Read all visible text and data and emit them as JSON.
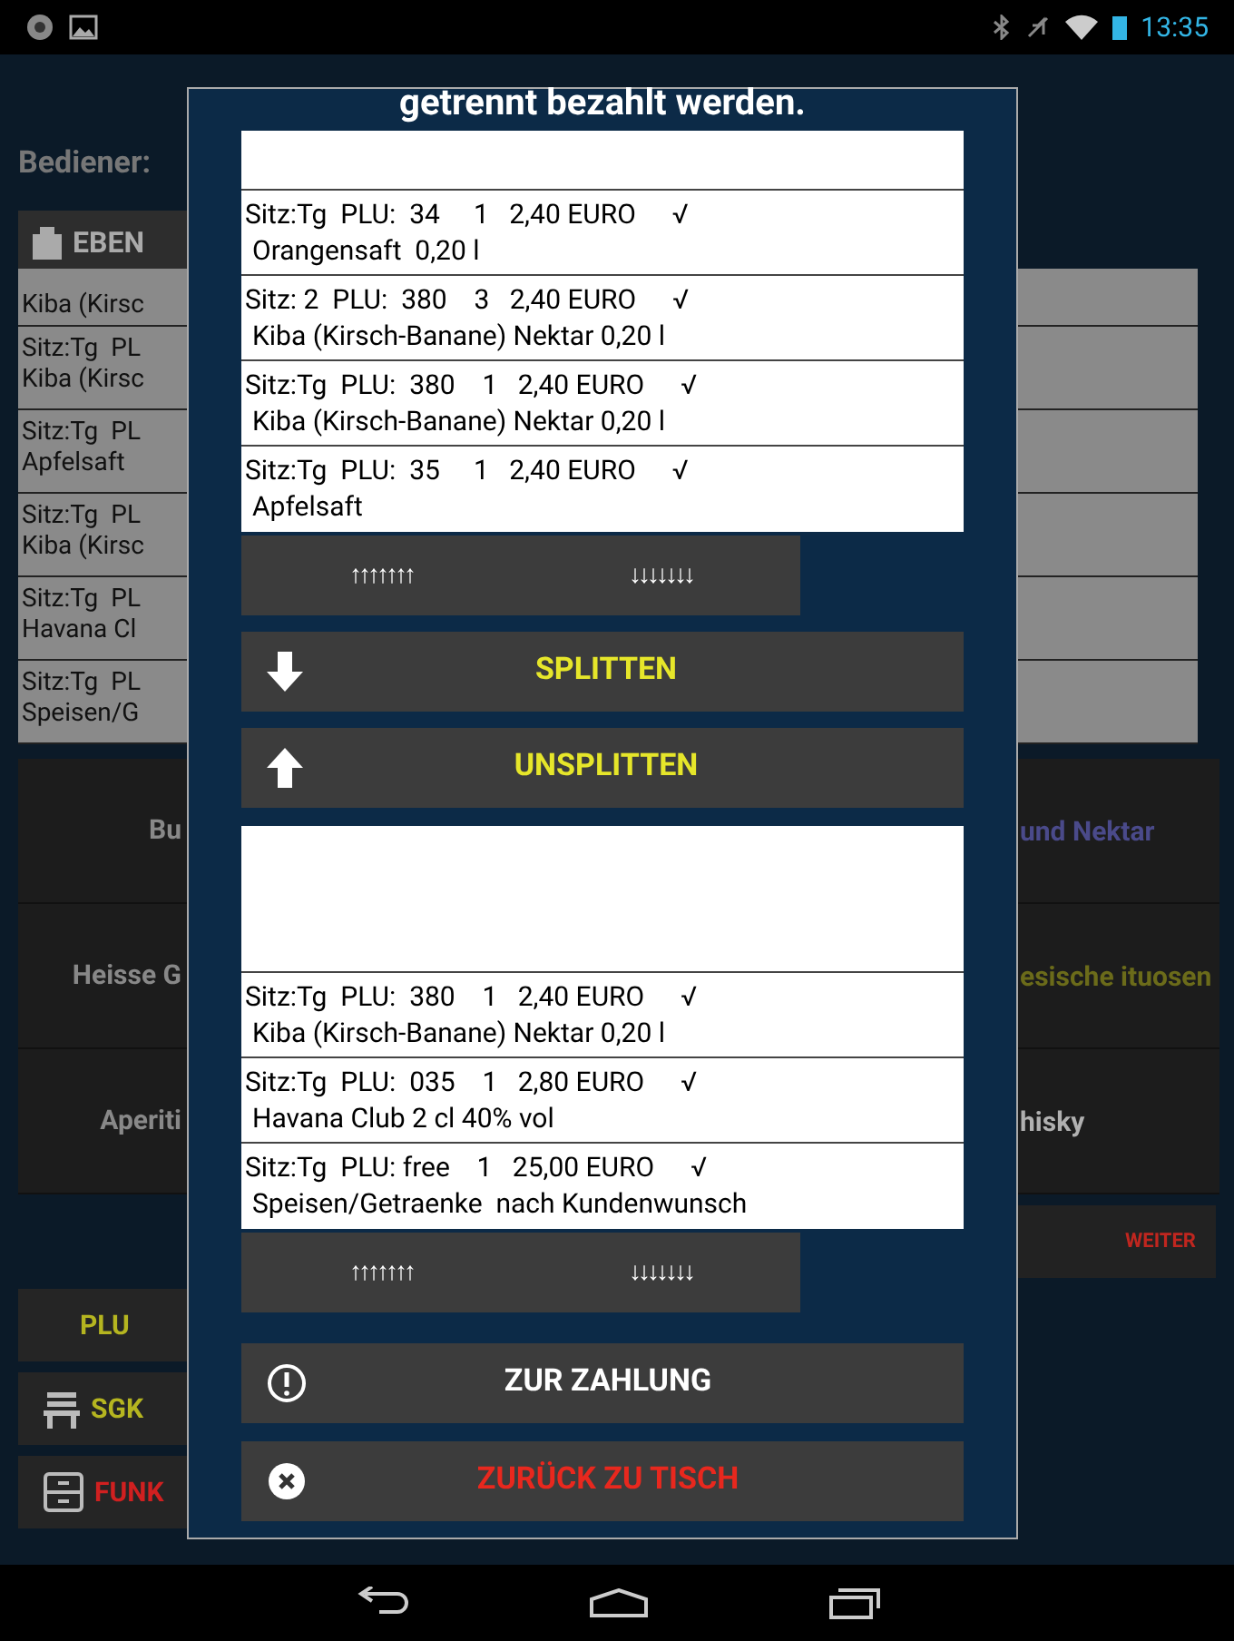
{
  "status_bar": {
    "time": "13:35"
  },
  "background": {
    "operator_label": "Bediener:",
    "level_button": "EBEN",
    "orders": [
      {
        "line2": "Kiba (Kirsc"
      },
      {
        "line1": "Sitz:Tg  PL",
        "line2": "Kiba (Kirsc"
      },
      {
        "line1": "Sitz:Tg  PL",
        "line2": "Apfelsaft"
      },
      {
        "line1": "Sitz:Tg  PL",
        "line2": "Kiba (Kirsc"
      },
      {
        "line1": "Sitz:Tg  PL",
        "line2": "Havana Cl"
      },
      {
        "line1": "Sitz:Tg  PL",
        "line2": "Speisen/G"
      }
    ],
    "category_buttons": [
      {
        "left": "Bu",
        "right": "und Nektar",
        "color": "#4a4a8a"
      },
      {
        "left": "Heisse G",
        "right": "esische ituosen",
        "color": "#6b6b1a"
      },
      {
        "left": "Aperiti",
        "right": "hisky",
        "color": "#b0b0b0"
      }
    ],
    "next_button": "WEITER",
    "function_buttons": [
      {
        "kind": "plu",
        "label": "PLU"
      },
      {
        "kind": "sgk",
        "label": "SGK"
      },
      {
        "kind": "funk",
        "label": "FUNK"
      }
    ]
  },
  "dialog": {
    "title": "getrennt bezahlt werden.",
    "upper_list": [
      {
        "line": "Sitz:Tg  PLU:  34     1   2,40 EURO",
        "check": "√",
        "name": "Orangensaft  0,20 l"
      },
      {
        "line": "Sitz: 2  PLU:  380    3   2,40 EURO",
        "check": "√",
        "name": "Kiba (Kirsch-Banane) Nektar 0,20 l"
      },
      {
        "line": "Sitz:Tg  PLU:  380    1   2,40 EURO",
        "check": "√",
        "name": "Kiba (Kirsch-Banane) Nektar 0,20 l"
      },
      {
        "line": "Sitz:Tg  PLU:  35     1   2,40 EURO",
        "check": "√",
        "name": "Apfelsaft"
      }
    ],
    "upper_scroll": {
      "up": "↑↑↑↑↑↑↑",
      "down": "↓↓↓↓↓↓↓"
    },
    "split_button": "SPLITTEN",
    "unsplit_button": "UNSPLITTEN",
    "lower_list": [
      {
        "line": "Sitz:Tg  PLU:  380    1   2,40 EURO",
        "check": "√",
        "name": "Kiba (Kirsch-Banane) Nektar 0,20 l"
      },
      {
        "line": "Sitz:Tg  PLU:  035    1   2,80 EURO",
        "check": "√",
        "name": "Havana Club 2 cl 40% vol"
      },
      {
        "line": "Sitz:Tg  PLU: free    1   25,00 EURO",
        "check": "√",
        "name": "Speisen/Getraenke  nach Kundenwunsch"
      }
    ],
    "lower_scroll": {
      "up": "↑↑↑↑↑↑↑",
      "down": "↓↓↓↓↓↓↓"
    },
    "pay_button": "ZUR ZAHLUNG",
    "back_button": "ZURÜCK ZU TISCH"
  }
}
